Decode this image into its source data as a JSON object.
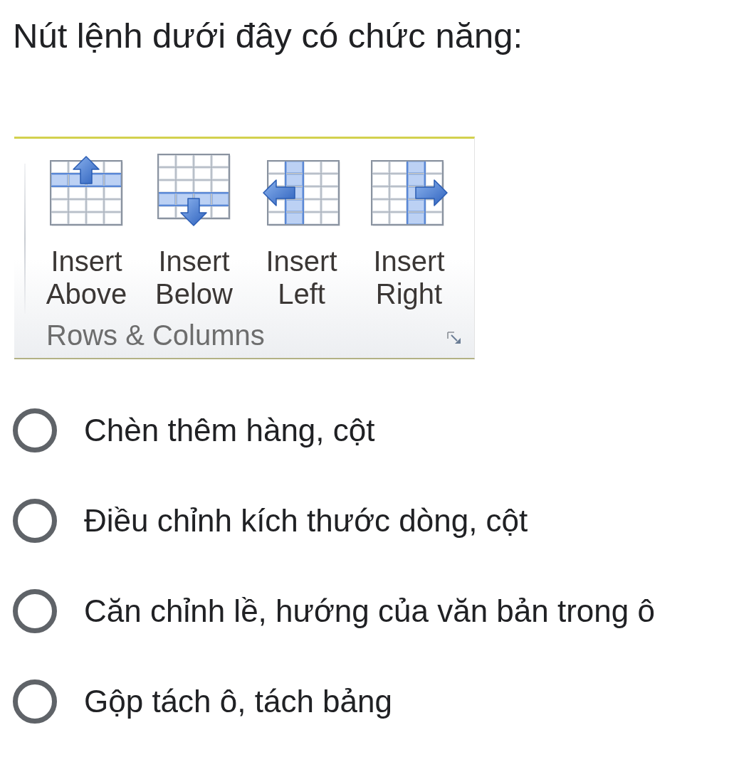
{
  "question": {
    "text": "Nút lệnh dưới đây có chức năng:"
  },
  "ribbon_group": {
    "buttons": [
      {
        "kind": "above",
        "label": "Insert Above"
      },
      {
        "kind": "below",
        "label": "Insert Below"
      },
      {
        "kind": "left",
        "label": "Insert Left"
      },
      {
        "kind": "right",
        "label": "Insert Right"
      }
    ],
    "title": "Rows & Columns"
  },
  "options": [
    {
      "label": "Chèn thêm hàng, cột",
      "selected": false
    },
    {
      "label": "Điều chỉnh kích thước dòng, cột",
      "selected": false
    },
    {
      "label": "Căn chỉnh lề, hướng của văn bản trong ô",
      "selected": false
    },
    {
      "label": "Gộp tách ô, tách bảng",
      "selected": false
    }
  ]
}
